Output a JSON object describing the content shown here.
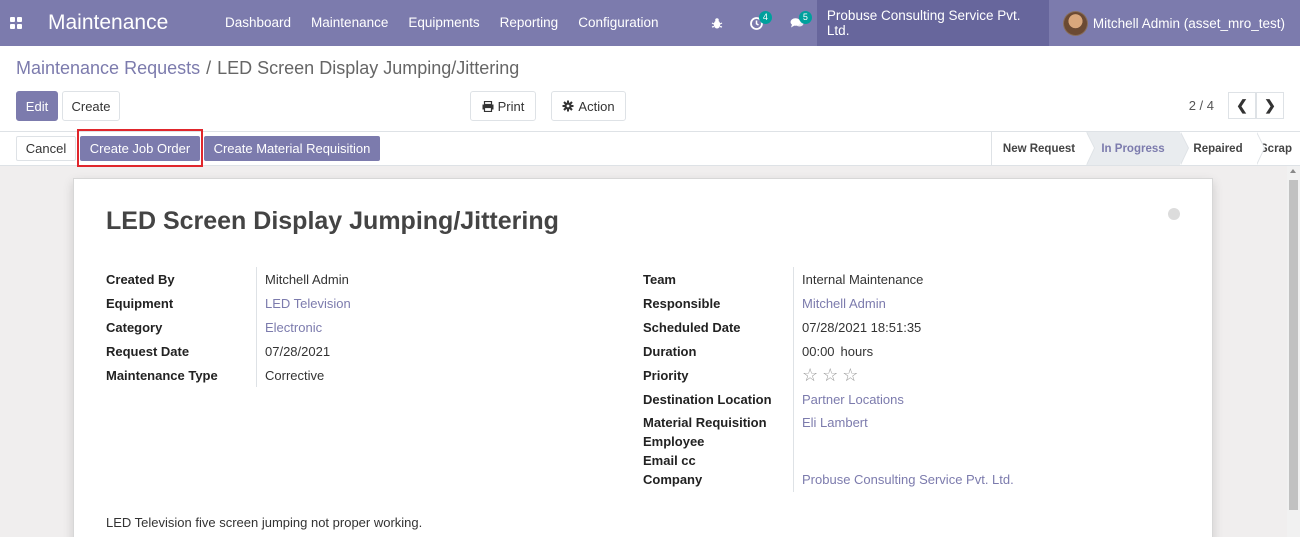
{
  "navbar": {
    "app_title": "Maintenance",
    "menu": [
      "Dashboard",
      "Maintenance",
      "Equipments",
      "Reporting",
      "Configuration"
    ],
    "activity_count": "4",
    "messages_count": "5",
    "company": "Probuse Consulting Service Pvt. Ltd.",
    "user": "Mitchell Admin (asset_mro_test)"
  },
  "breadcrumb": {
    "parent": "Maintenance Requests",
    "separator": "/",
    "current": "LED Screen Display Jumping/Jittering"
  },
  "buttons": {
    "edit": "Edit",
    "create": "Create",
    "print": "Print",
    "action": "Action"
  },
  "pager": {
    "value": "2 / 4"
  },
  "statusbar": {
    "cancel": "Cancel",
    "create_job_order": "Create Job Order",
    "create_material_requisition": "Create Material Requisition",
    "stages": [
      "New Request",
      "In Progress",
      "Repaired",
      "Scrap"
    ],
    "active_stage": "In Progress"
  },
  "form": {
    "title": "LED Screen Display Jumping/Jittering",
    "left": [
      {
        "label": "Created By",
        "value": "Mitchell Admin",
        "link": false
      },
      {
        "label": "Equipment",
        "value": "LED Television",
        "link": true
      },
      {
        "label": "Category",
        "value": "Electronic",
        "link": true
      },
      {
        "label": "Request Date",
        "value": "07/28/2021",
        "link": false
      },
      {
        "label": "Maintenance Type",
        "value": "Corrective",
        "link": false
      }
    ],
    "right": {
      "team_label": "Team",
      "team": "Internal Maintenance",
      "responsible_label": "Responsible",
      "responsible": "Mitchell Admin",
      "scheduled_label": "Scheduled Date",
      "scheduled": "07/28/2021 18:51:35",
      "duration_label": "Duration",
      "duration": "00:00",
      "duration_unit": "hours",
      "priority_label": "Priority",
      "priority_stars": 0,
      "destination_label": "Destination Location",
      "destination": "Partner Locations",
      "material_label": "Material Requisition",
      "material": "Eli Lambert",
      "employee_label": "Employee",
      "email_label": "Email cc",
      "company_label": "Company",
      "company": "Probuse Consulting Service Pvt. Ltd."
    },
    "description": "LED Television five screen jumping not proper working."
  }
}
